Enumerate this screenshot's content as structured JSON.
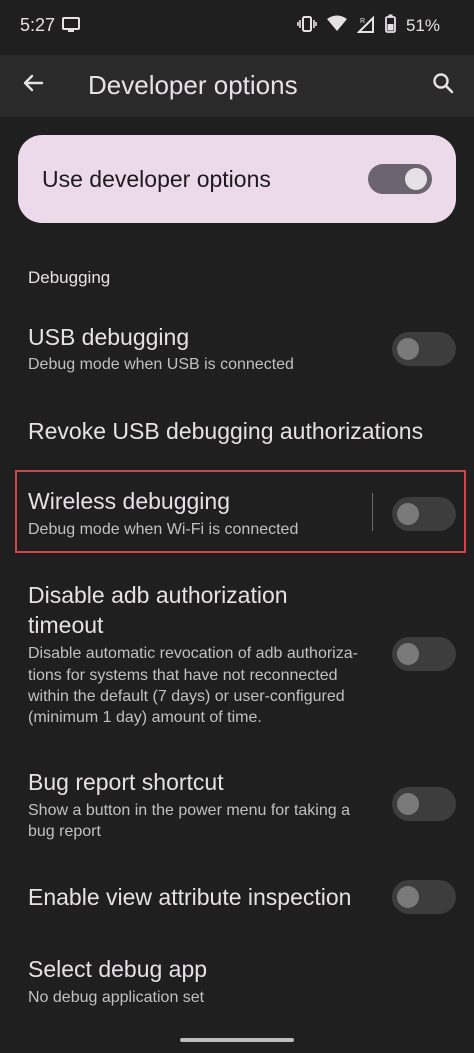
{
  "status_bar": {
    "time": "5:27",
    "battery_percent": "51%",
    "icons": [
      "cast-icon",
      "vibrate-icon",
      "wifi-icon",
      "signal-r-icon",
      "battery-icon"
    ]
  },
  "app_bar": {
    "title": "Developer options",
    "back_icon": "arrow-back-icon",
    "search_icon": "search-icon"
  },
  "master_toggle": {
    "label": "Use developer options",
    "checked": true
  },
  "sections": [
    {
      "header": "Debugging",
      "items": [
        {
          "title": "USB debugging",
          "subtitle": "Debug mode when USB is connected",
          "toggle": false
        },
        {
          "title": "Revoke USB debugging authorizations"
        },
        {
          "title": "Wireless debugging",
          "subtitle": "Debug mode when Wi-Fi is connected",
          "toggle": false,
          "highlighted": true
        },
        {
          "title_line1": "Disable adb authorization",
          "title_line2": "timeout",
          "subtitle_line1": "Disable automatic revocation of adb authoriza-",
          "subtitle_line2": "tions for systems that have not reconnected",
          "subtitle_line3": "within the default (7 days) or user-configured",
          "subtitle_line4": "(minimum 1 day) amount of time.",
          "toggle": false
        },
        {
          "title": "Bug report shortcut",
          "subtitle_line1": "Show a button in the power menu for taking a",
          "subtitle_line2": "bug report",
          "toggle": false
        },
        {
          "title": "Enable view attribute inspection",
          "toggle": false
        },
        {
          "title": "Select debug app",
          "subtitle": "No debug application set"
        }
      ]
    }
  ],
  "colors": {
    "background": "#1f1f1f",
    "app_bar": "#2a2a2a",
    "master_card": "#ecdaea",
    "highlight_border": "#d3434a"
  }
}
